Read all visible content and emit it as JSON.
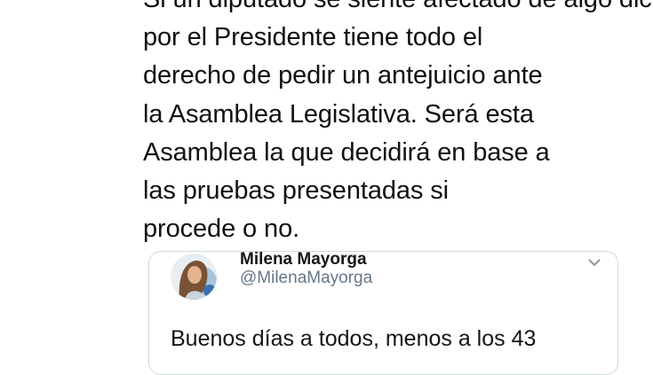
{
  "tweet": {
    "lines": [
      "Si un diputado se siente afectado de algo dicho",
      "por el Presidente tiene todo el",
      "derecho de pedir un antejuicio ante",
      "la Asamblea Legislativa. Será esta",
      "Asamblea la que decidirá en base a",
      "las pruebas presentadas si",
      "procede o no."
    ]
  },
  "quoted_tweet": {
    "author_name": "Milena Mayorga",
    "author_handle": "@MilenaMayorga",
    "text": "Buenos días a todos, menos a los 43",
    "menu_icon": "chevron-down-icon",
    "avatar_icon": "profile-photo"
  }
}
